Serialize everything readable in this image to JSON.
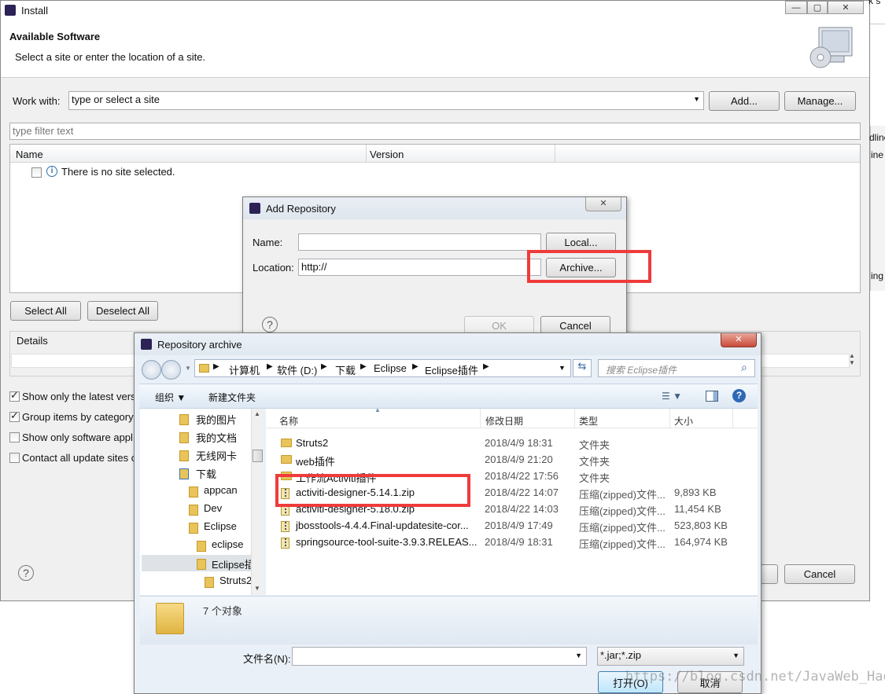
{
  "install": {
    "title": "Install",
    "banner_title": "Available Software",
    "banner_subtitle": "Select a site or enter the location of a site.",
    "work_with_label": "Work with:",
    "work_with_value": "type or select a site",
    "add_button": "Add...",
    "manage_button": "Manage...",
    "filter_placeholder": "type filter text",
    "col_name": "Name",
    "col_version": "Version",
    "no_site": "There is no site selected.",
    "select_all": "Select All",
    "deselect_all": "Deselect All",
    "details_label": "Details",
    "options": [
      {
        "label": "Show only the latest vers",
        "checked": true
      },
      {
        "label": "Group items by category",
        "checked": true
      },
      {
        "label": "Show only software appl",
        "checked": false
      },
      {
        "label": "Contact all update sites c",
        "checked": false
      }
    ],
    "cancel_button": "Cancel",
    "right_fragments": [
      "k s",
      "dline",
      "ine",
      "ing"
    ]
  },
  "add_repo": {
    "title": "Add Repository",
    "name_label": "Name:",
    "name_value": "",
    "location_label": "Location:",
    "location_value": "http://",
    "local_button": "Local...",
    "archive_button": "Archive...",
    "ok_button": "OK",
    "cancel_button": "Cancel"
  },
  "archive_dialog": {
    "title": "Repository archive",
    "breadcrumb": [
      "计算机",
      "软件 (D:)",
      "下载",
      "Eclipse",
      "Eclipse插件"
    ],
    "search_placeholder": "搜索 Eclipse插件",
    "organize": "组织 ▼",
    "new_folder": "新建文件夹",
    "tree": [
      {
        "label": "我的图片",
        "indent": 0
      },
      {
        "label": "我的文档",
        "indent": 0
      },
      {
        "label": "无线网卡",
        "indent": 0
      },
      {
        "label": "下载",
        "indent": 0
      },
      {
        "label": "appcan",
        "indent": 1
      },
      {
        "label": "Dev",
        "indent": 1
      },
      {
        "label": "Eclipse",
        "indent": 1
      },
      {
        "label": "eclipse",
        "indent": 2
      },
      {
        "label": "Eclipse插",
        "indent": 2
      },
      {
        "label": "Struts2",
        "indent": 3
      }
    ],
    "columns": {
      "name": "名称",
      "date": "修改日期",
      "type": "类型",
      "size": "大小"
    },
    "files": [
      {
        "name": "Struts2",
        "date": "2018/4/9 18:31",
        "type": "文件夹",
        "size": "",
        "icon": "folder"
      },
      {
        "name": "web插件",
        "date": "2018/4/9 21:20",
        "type": "文件夹",
        "size": "",
        "icon": "folder"
      },
      {
        "name": "工作流Activiti插件",
        "date": "2018/4/22 17:56",
        "type": "文件夹",
        "size": "",
        "icon": "folder"
      },
      {
        "name": "activiti-designer-5.14.1.zip",
        "date": "2018/4/22 14:07",
        "type": "压缩(zipped)文件...",
        "size": "9,893 KB",
        "icon": "zip"
      },
      {
        "name": "activiti-designer-5.18.0.zip",
        "date": "2018/4/22 14:03",
        "type": "压缩(zipped)文件...",
        "size": "11,454 KB",
        "icon": "zip"
      },
      {
        "name": "jbosstools-4.4.4.Final-updatesite-cor...",
        "date": "2018/4/9 17:49",
        "type": "压缩(zipped)文件...",
        "size": "523,803 KB",
        "icon": "zip"
      },
      {
        "name": "springsource-tool-suite-3.9.3.RELEAS...",
        "date": "2018/4/9 18:31",
        "type": "压缩(zipped)文件...",
        "size": "164,974 KB",
        "icon": "zip"
      }
    ],
    "item_count": "7 个对象",
    "filename_label": "文件名(N):",
    "filename_value": "",
    "filter_value": "*.jar;*.zip",
    "open_button": "打开(O)",
    "cancel_button": "取消"
  },
  "watermark": "https://blog.csdn.net/JavaWeb_Hao",
  "colors": {
    "highlight": "#ef3b3b",
    "accent": "#3c7fb1"
  }
}
